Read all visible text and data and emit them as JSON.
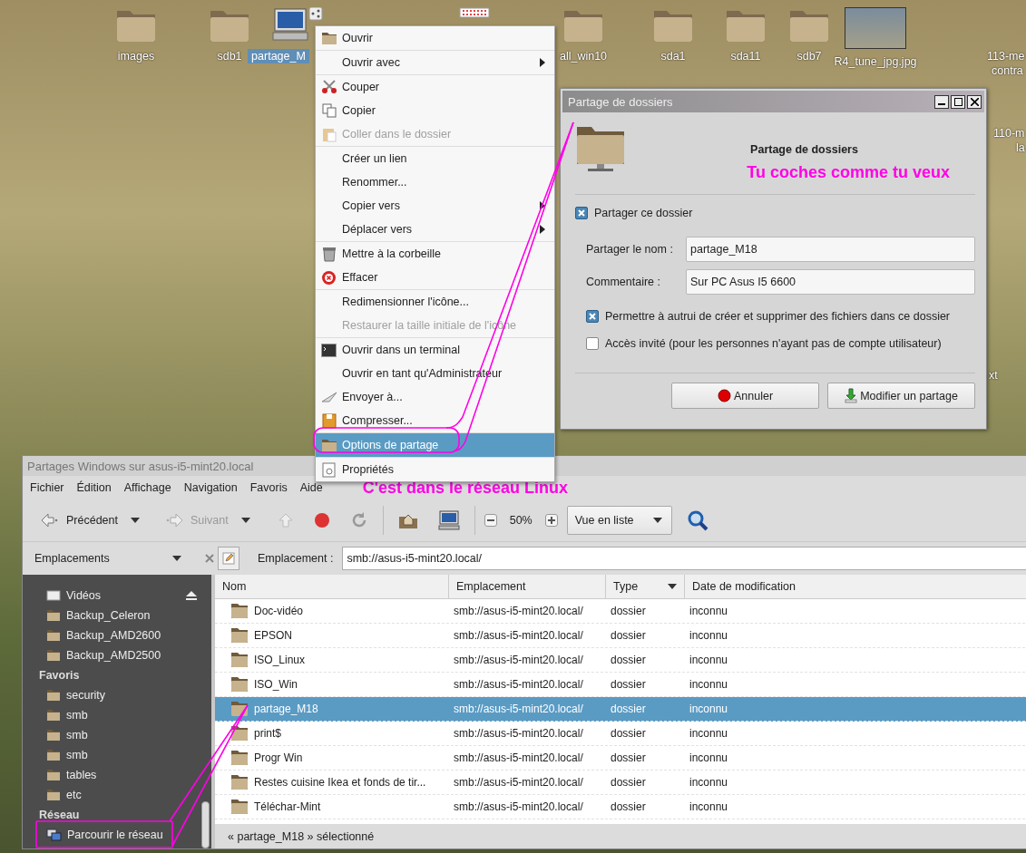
{
  "desktop": {
    "icons": [
      {
        "label": "images",
        "kind": "folder",
        "selected": false
      },
      {
        "label": "sdb1",
        "kind": "folder",
        "selected": false
      },
      {
        "label": "partage_M",
        "kind": "computer",
        "selected": true
      },
      {
        "kind": "drive",
        "selected": false
      },
      {
        "label": "all_win10",
        "kind": "folder",
        "selected": false
      },
      {
        "label": "sda1",
        "kind": "folder",
        "selected": false
      },
      {
        "label": "sda11",
        "kind": "folder",
        "selected": false
      },
      {
        "label": "sdb7",
        "kind": "folder",
        "selected": false
      },
      {
        "label": "R4_tune_jpg.jpg",
        "kind": "photo",
        "selected": false
      }
    ],
    "edge_labels": [
      "113-me",
      "contra",
      "110-m",
      "la",
      "xt"
    ]
  },
  "context_menu": {
    "groups": [
      [
        {
          "label": "Ouvrir",
          "kind": "folder",
          "submenu": false,
          "disabled": false,
          "selected": false
        }
      ],
      [
        {
          "label": "Ouvrir avec",
          "kind": "plain",
          "submenu": true,
          "disabled": false,
          "selected": false
        }
      ],
      [
        {
          "label": "Couper",
          "kind": "scissors",
          "submenu": false,
          "disabled": false,
          "selected": false
        },
        {
          "label": "Copier",
          "kind": "copy",
          "submenu": false,
          "disabled": false,
          "selected": false
        },
        {
          "label": "Coller dans le dossier",
          "kind": "paste",
          "submenu": false,
          "disabled": true,
          "selected": false
        }
      ],
      [
        {
          "label": "Créer un lien",
          "kind": "plain",
          "submenu": false,
          "disabled": false,
          "selected": false
        },
        {
          "label": "Renommer...",
          "kind": "plain",
          "submenu": false,
          "disabled": false,
          "selected": false
        },
        {
          "label": "Copier vers",
          "kind": "plain",
          "submenu": true,
          "disabled": false,
          "selected": false
        },
        {
          "label": "Déplacer vers",
          "kind": "plain",
          "submenu": true,
          "disabled": false,
          "selected": false
        }
      ],
      [
        {
          "label": "Mettre à la corbeille",
          "kind": "trash",
          "submenu": false,
          "disabled": false,
          "selected": false
        },
        {
          "label": "Effacer",
          "kind": "delete",
          "submenu": false,
          "disabled": false,
          "selected": false
        }
      ],
      [
        {
          "label": "Redimensionner l'icône...",
          "kind": "plain",
          "submenu": false,
          "disabled": false,
          "selected": false
        },
        {
          "label": "Restaurer la taille initiale de l'icône",
          "kind": "plain",
          "submenu": false,
          "disabled": true,
          "selected": false
        }
      ],
      [
        {
          "label": "Ouvrir dans un terminal",
          "kind": "terminal",
          "submenu": false,
          "disabled": false,
          "selected": false
        },
        {
          "label": "Ouvrir en tant qu'Administrateur",
          "kind": "plain",
          "submenu": false,
          "disabled": false,
          "selected": false
        },
        {
          "label": "Envoyer à...",
          "kind": "send",
          "submenu": false,
          "disabled": false,
          "selected": false
        },
        {
          "label": "Compresser...",
          "kind": "archive",
          "submenu": false,
          "disabled": false,
          "selected": false
        }
      ],
      [
        {
          "label": "Options de partage",
          "kind": "folder",
          "submenu": false,
          "disabled": false,
          "selected": true
        }
      ],
      [
        {
          "label": "Propriétés",
          "kind": "properties",
          "submenu": false,
          "disabled": false,
          "selected": false
        }
      ]
    ]
  },
  "dialog": {
    "title": "Partage de dossiers",
    "heading": "Partage de dossiers",
    "annotation": "Tu coches comme tu veux",
    "share_checkbox": {
      "label": "Partager ce dossier",
      "checked": true
    },
    "fields": [
      {
        "label": "Partager le nom :",
        "value": "partage_M18"
      },
      {
        "label": "Commentaire :",
        "value": "Sur PC Asus I5 6600"
      }
    ],
    "options": [
      {
        "label": "Permettre à autrui de créer et supprimer des fichiers dans ce dossier",
        "checked": true
      },
      {
        "label": "Accès invité (pour les personnes n'ayant pas de compte utilisateur)",
        "checked": false
      }
    ],
    "buttons": [
      {
        "label": "Annuler",
        "kind": "cancel"
      },
      {
        "label": "Modifier un partage",
        "kind": "apply"
      }
    ]
  },
  "file_manager": {
    "title": "Partages Windows sur asus-i5-mint20.local",
    "menu": [
      "Fichier",
      "Édition",
      "Affichage",
      "Navigation",
      "Favoris",
      "Aide"
    ],
    "annotation": "C'est dans le réseau Linux",
    "toolbar": {
      "back": {
        "label": "Précédent",
        "disabled": false
      },
      "forward": {
        "label": "Suivant",
        "disabled": true
      },
      "up": {
        "disabled": true
      },
      "zoom": "50%",
      "view": "Vue en liste"
    },
    "sidebar": {
      "title": "Emplacements",
      "groups": [
        {
          "items": [
            {
              "label": "Vidéos",
              "kind": "drive",
              "ejectable": true,
              "selected": false
            },
            {
              "label": "Backup_Celeron",
              "kind": "folder",
              "ejectable": false,
              "selected": false
            },
            {
              "label": "Backup_AMD2600",
              "kind": "folder",
              "ejectable": false,
              "selected": false
            },
            {
              "label": "Backup_AMD2500",
              "kind": "folder",
              "ejectable": false,
              "selected": false
            }
          ]
        },
        {
          "heading": "Favoris",
          "items": [
            {
              "label": "security",
              "kind": "folder",
              "ejectable": false,
              "selected": false
            },
            {
              "label": "smb",
              "kind": "folder",
              "ejectable": false,
              "selected": false
            },
            {
              "label": "smb",
              "kind": "folder",
              "ejectable": false,
              "selected": false
            },
            {
              "label": "smb",
              "kind": "folder",
              "ejectable": false,
              "selected": false
            },
            {
              "label": "tables",
              "kind": "folder",
              "ejectable": false,
              "selected": false
            },
            {
              "label": "etc",
              "kind": "folder",
              "ejectable": false,
              "selected": false
            }
          ]
        },
        {
          "heading": "Réseau",
          "items": [
            {
              "label": "Parcourir le réseau",
              "kind": "network",
              "ejectable": false,
              "selected": false
            }
          ]
        }
      ]
    },
    "location": {
      "label": "Emplacement :",
      "value": "smb://asus-i5-mint20.local/"
    },
    "table": {
      "columns": [
        {
          "label": "Nom",
          "sorted": false
        },
        {
          "label": "Emplacement",
          "sorted": false
        },
        {
          "label": "Type",
          "sorted": true
        },
        {
          "label": "Date de modification",
          "sorted": false
        }
      ],
      "rows": [
        {
          "cells": [
            "Doc-vidéo",
            "smb://asus-i5-mint20.local/",
            "dossier",
            "inconnu"
          ],
          "selected": false
        },
        {
          "cells": [
            "EPSON",
            "smb://asus-i5-mint20.local/",
            "dossier",
            "inconnu"
          ],
          "selected": false
        },
        {
          "cells": [
            "ISO_Linux",
            "smb://asus-i5-mint20.local/",
            "dossier",
            "inconnu"
          ],
          "selected": false
        },
        {
          "cells": [
            "ISO_Win",
            "smb://asus-i5-mint20.local/",
            "dossier",
            "inconnu"
          ],
          "selected": false
        },
        {
          "cells": [
            "partage_M18",
            "smb://asus-i5-mint20.local/",
            "dossier",
            "inconnu"
          ],
          "selected": true
        },
        {
          "cells": [
            "print$",
            "smb://asus-i5-mint20.local/",
            "dossier",
            "inconnu"
          ],
          "selected": false
        },
        {
          "cells": [
            "Progr Win",
            "smb://asus-i5-mint20.local/",
            "dossier",
            "inconnu"
          ],
          "selected": false
        },
        {
          "cells": [
            "Restes cuisine Ikea et fonds de tir...",
            "smb://asus-i5-mint20.local/",
            "dossier",
            "inconnu"
          ],
          "selected": false
        },
        {
          "cells": [
            "Téléchar-Mint",
            "smb://asus-i5-mint20.local/",
            "dossier",
            "inconnu"
          ],
          "selected": false
        }
      ]
    },
    "status": "« partage_M18 » sélectionné"
  }
}
